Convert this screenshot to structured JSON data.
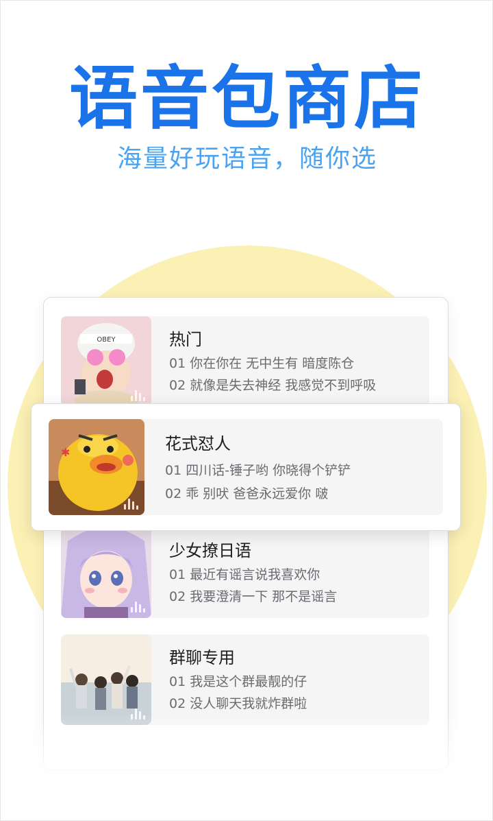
{
  "header": {
    "title": "语音包商店",
    "subtitle": "海量好玩语音，随你选"
  },
  "packs": [
    {
      "name": "热门",
      "line1": "01 你在你在 无中生有 暗度陈仓",
      "line2": "02 就像是失去神经 我感觉不到呼吸",
      "thumb_icon": "boy-with-heart-glasses"
    },
    {
      "name": "花式怼人",
      "line1": "01 四川话-锤子哟 你晓得个铲铲",
      "line2": "02 乖 别吠 爸爸永远爱你 啵",
      "thumb_icon": "angry-yellow-duck"
    },
    {
      "name": "少女撩日语",
      "line1": "01 最近有谣言说我喜欢你",
      "line2": "02 我要澄清一下 那不是谣言",
      "thumb_icon": "anime-girl"
    },
    {
      "name": "群聊专用",
      "line1": "01 我是这个群最靓的仔",
      "line2": "02 没人聊天我就炸群啦",
      "thumb_icon": "friends-group-photo"
    }
  ],
  "colors": {
    "title": "#1a73e8",
    "subtitle": "#4aa3f0",
    "sun": "#fbf1b5",
    "card": "#f5f5f6"
  }
}
